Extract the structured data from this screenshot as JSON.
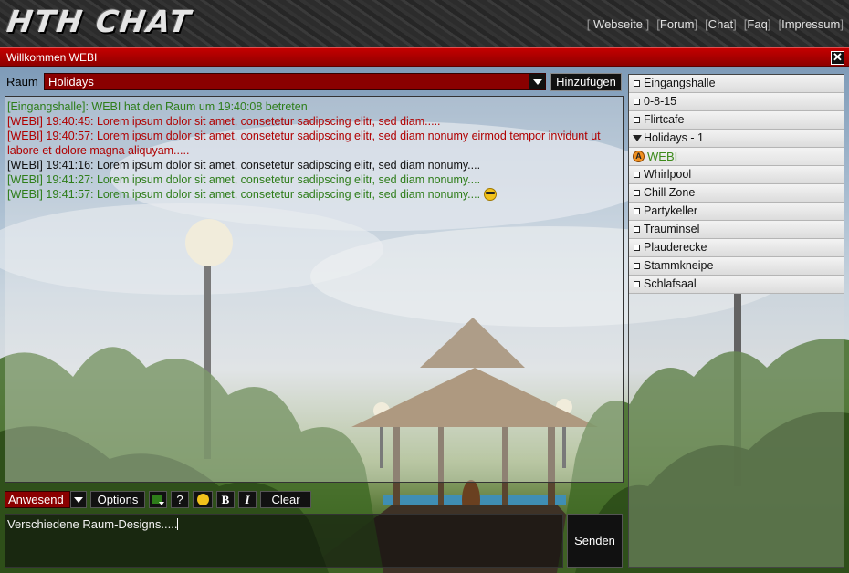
{
  "header": {
    "logo": "HTH CHAT",
    "nav": [
      "Webseite",
      "Forum",
      "Chat",
      "Faq",
      "Impressum"
    ]
  },
  "titlebar": {
    "title": "Willkommen WEBI",
    "close": "✕"
  },
  "room_bar": {
    "label": "Raum",
    "selected_room": "Holidays",
    "add_button": "Hinzufügen"
  },
  "messages": [
    {
      "text": "[Eingangshalle]: WEBI hat den Raum um 19:40:08 betreten",
      "color": "#2e7d1a"
    },
    {
      "text": "[WEBI] 19:40:45: Lorem ipsum dolor sit amet, consetetur sadipscing elitr, sed diam.....",
      "color": "#b00000"
    },
    {
      "text": "[WEBI] 19:40:57: Lorem ipsum dolor sit amet, consetetur sadipscing elitr, sed diam nonumy eirmod tempor invidunt ut labore et dolore magna aliquyam.....",
      "color": "#b00000"
    },
    {
      "text": "[WEBI] 19:41:16: Lorem ipsum dolor sit amet, consetetur sadipscing elitr, sed diam nonumy....",
      "color": "#111111"
    },
    {
      "text": "[WEBI] 19:41:27: Lorem ipsum dolor sit amet, consetetur sadipscing elitr, sed diam nonumy....",
      "color": "#2e7d1a"
    },
    {
      "text": "[WEBI] 19:41:57: Lorem ipsum dolor sit amet, consetetur sadipscing elitr, sed diam nonumy....",
      "color": "#2e7d1a",
      "smiley": "sunglasses-smiley-icon"
    }
  ],
  "rooms": [
    {
      "name": "Eingangshalle",
      "open": false
    },
    {
      "name": "0-8-15",
      "open": false
    },
    {
      "name": "Flirtcafe",
      "open": false
    },
    {
      "name": "Holidays - 1",
      "open": true,
      "users": [
        {
          "name": "WEBI",
          "badge": "A"
        }
      ]
    },
    {
      "name": "Whirlpool",
      "open": false
    },
    {
      "name": "Chill Zone",
      "open": false
    },
    {
      "name": "Partykeller",
      "open": false
    },
    {
      "name": "Trauminsel",
      "open": false
    },
    {
      "name": "Plauderecke",
      "open": false
    },
    {
      "name": "Stammkneipe",
      "open": false
    },
    {
      "name": "Schlafsaal",
      "open": false
    }
  ],
  "toolbar": {
    "status": "Anwesend",
    "options": "Options",
    "help": "?",
    "bold": "B",
    "italic": "I",
    "clear": "Clear"
  },
  "input": {
    "value": "Verschiedene Raum-Designs....."
  },
  "send_button": "Senden",
  "colors": {
    "accent_red": "#8a0000",
    "user_green": "#2e7d1a",
    "title_red": "#c40000"
  }
}
